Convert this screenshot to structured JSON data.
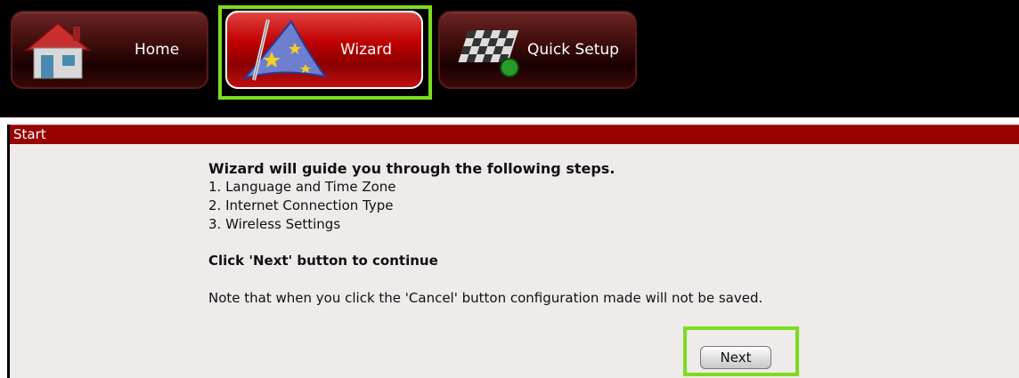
{
  "nav": {
    "home_label": "Home",
    "wizard_label": "Wizard",
    "quick_setup_label": "Quick Setup",
    "active": "wizard",
    "icons": {
      "home": "house-icon",
      "wizard": "wizard-hat-icon",
      "quick_setup": "checkered-flag-icon"
    }
  },
  "panel": {
    "title": "Start",
    "heading": "Wizard will guide you through the following steps.",
    "steps": [
      "1. Language and Time Zone",
      "2. Internet Connection Type",
      "3. Wireless Settings"
    ],
    "cta": "Click 'Next' button to continue",
    "note": "Note that when you click the 'Cancel' button configuration made will not be saved.",
    "next_label": "Next"
  },
  "colors": {
    "header_red": "#990000",
    "active_red": "#c00000",
    "highlight_green": "#7ddc1f",
    "panel_bg": "#efebea"
  }
}
